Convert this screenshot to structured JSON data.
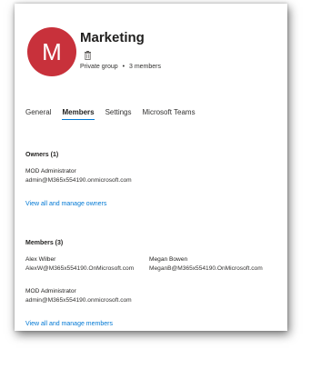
{
  "group": {
    "avatar_letter": "M",
    "name": "Marketing",
    "type": "Private group",
    "members_count": "3 members"
  },
  "tabs": [
    {
      "label": "General",
      "active": false
    },
    {
      "label": "Members",
      "active": true
    },
    {
      "label": "Settings",
      "active": false
    },
    {
      "label": "Microsoft Teams",
      "active": false
    }
  ],
  "owners": {
    "heading": "Owners (1)",
    "people": [
      {
        "name": "MOD Administrator",
        "email": "admin@M365x554190.onmicrosoft.com"
      }
    ],
    "link": "View all and manage owners"
  },
  "members": {
    "heading": "Members (3)",
    "people": [
      {
        "name": "Alex Wilber",
        "email": "AlexW@M365x554190.OnMicrosoft.com"
      },
      {
        "name": "Megan Bowen",
        "email": "MeganB@M365x554190.OnMicrosoft.com"
      },
      {
        "name": "MOD Administrator",
        "email": "admin@M365x554190.onmicrosoft.com"
      }
    ],
    "link": "View all and manage members"
  },
  "colors": {
    "avatar": "#c8313b",
    "accent": "#0078d4"
  },
  "icons": {
    "delete": "trash-icon"
  }
}
